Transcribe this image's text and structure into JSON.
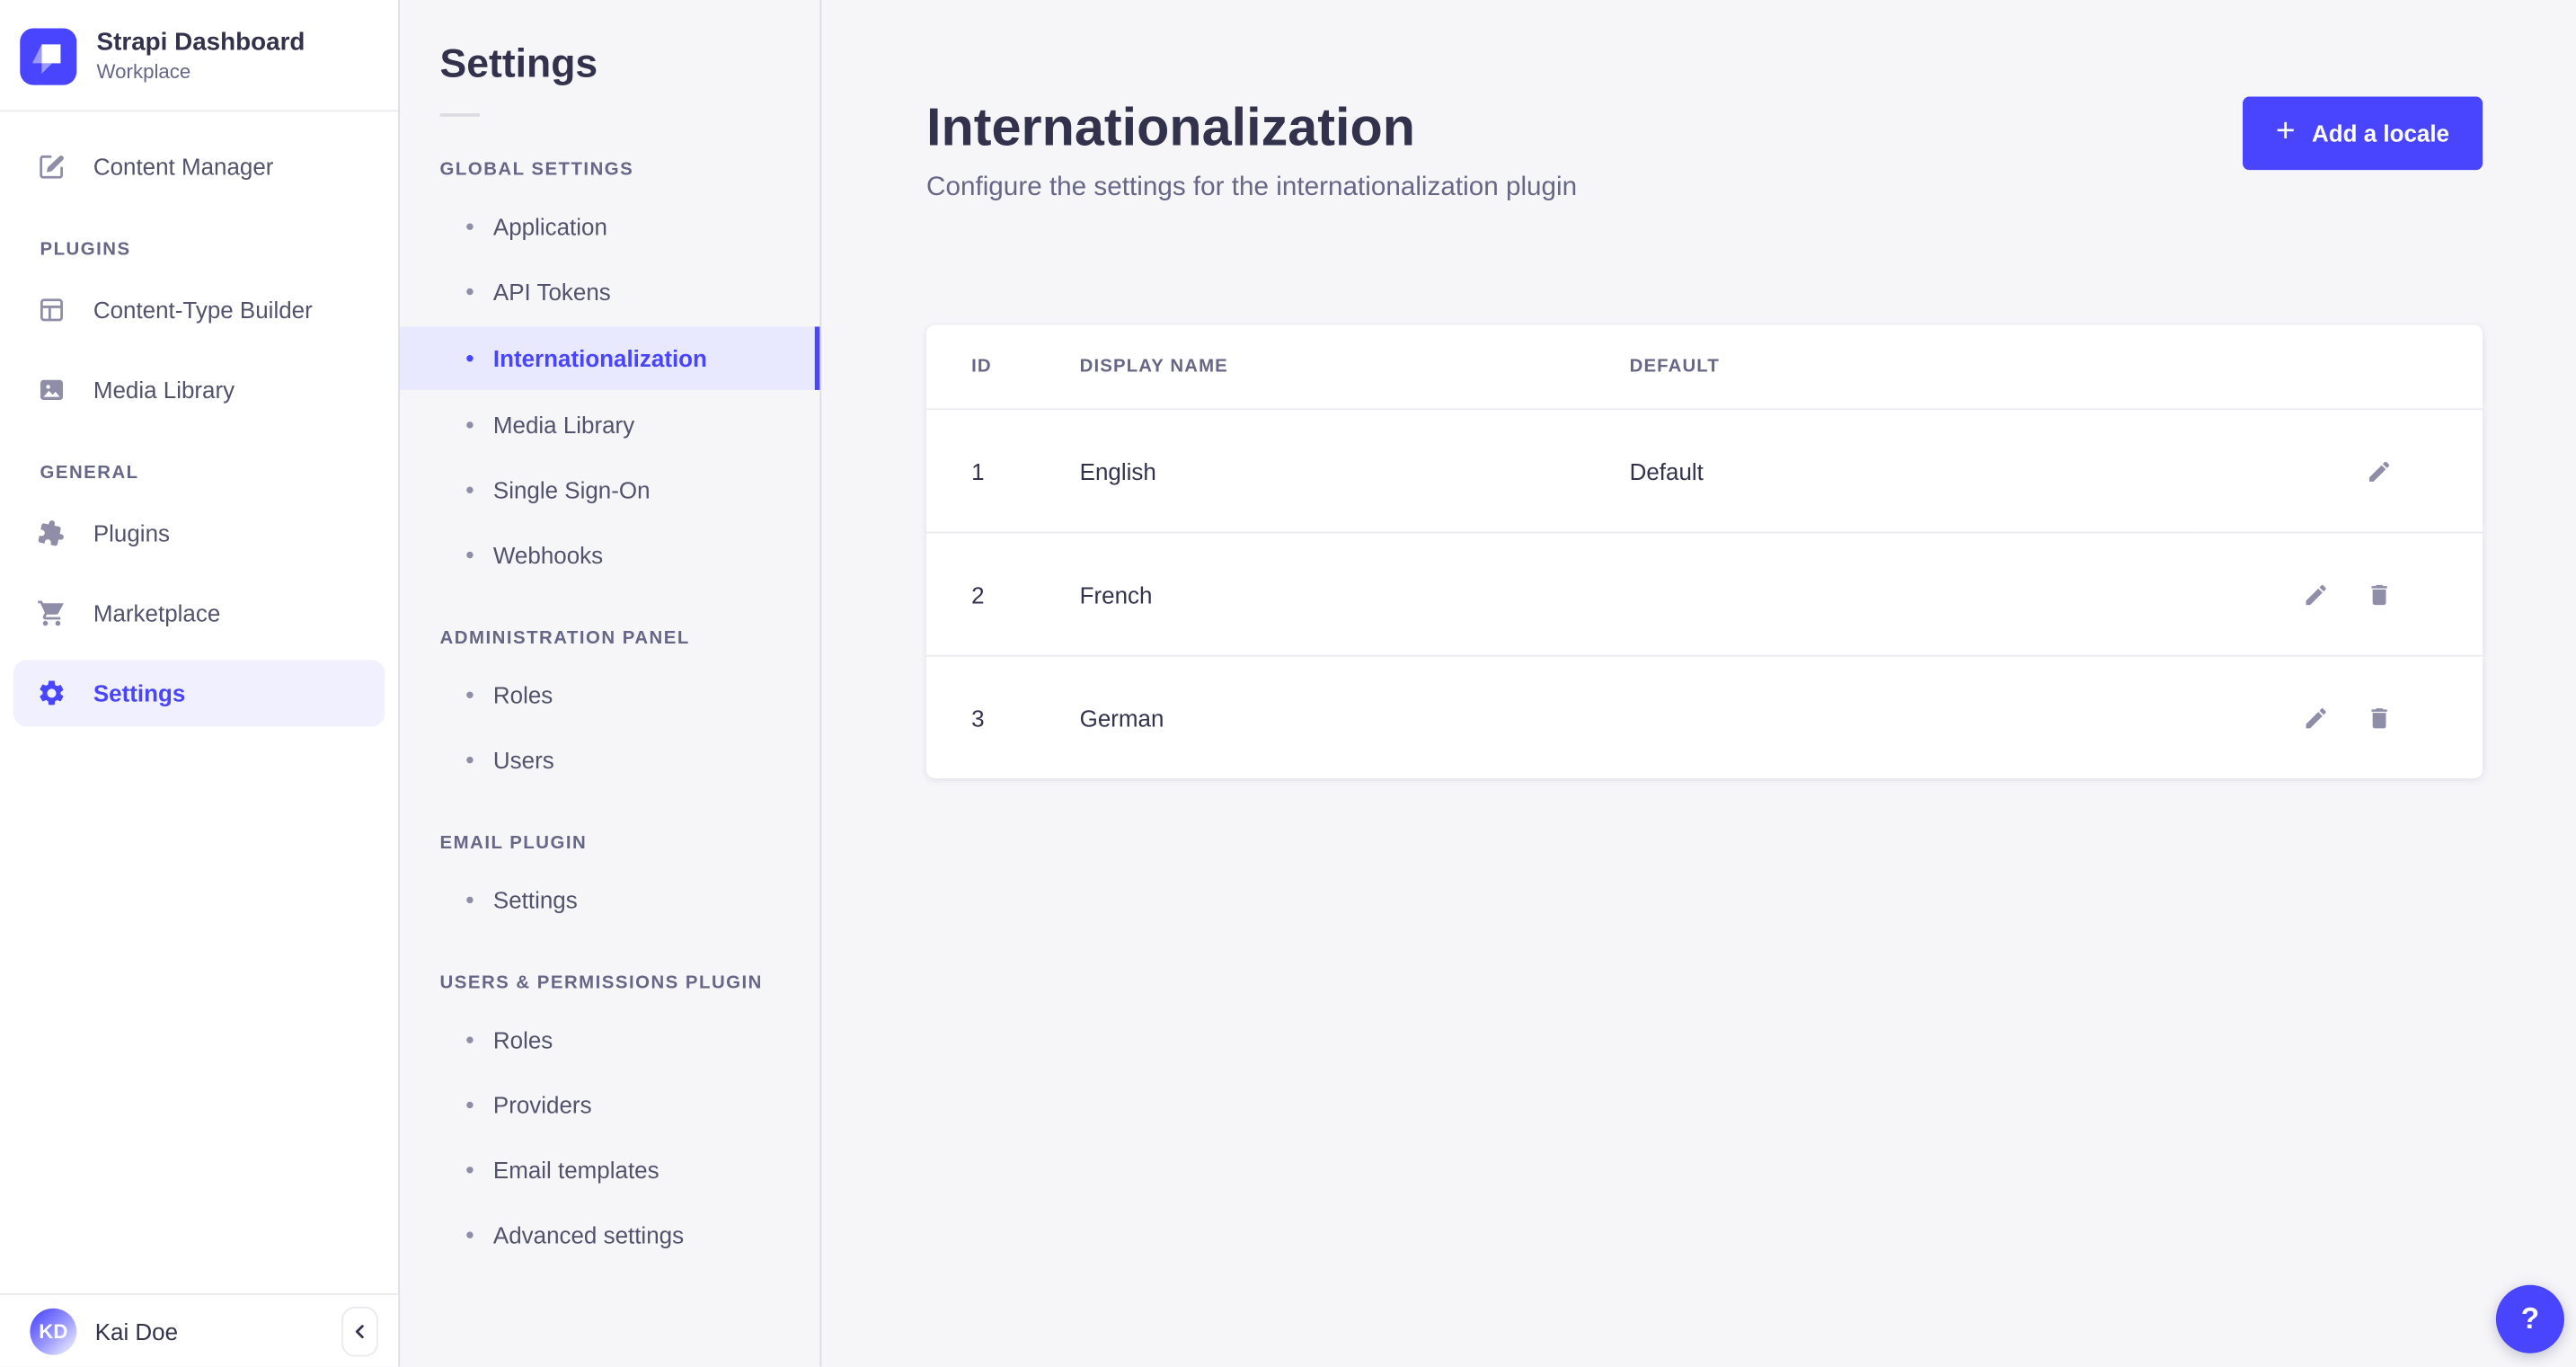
{
  "app": {
    "brand": {
      "title": "Strapi Dashboard",
      "subtitle": "Workplace"
    }
  },
  "colors": {
    "primary": "#4945ff",
    "primary_highlight": "#f0f0ff",
    "background": "#f6f6f9",
    "surface": "#ffffff",
    "border": "#eaeaef",
    "text_dark": "#32324d",
    "text_muted": "#666687",
    "icon_gray": "#8e8ea9"
  },
  "sidebar": {
    "content_manager": "Content Manager",
    "sections": [
      {
        "title": "PLUGINS",
        "items": [
          "Content-Type Builder",
          "Media Library"
        ]
      },
      {
        "title": "GENERAL",
        "items": [
          "Plugins",
          "Marketplace",
          "Settings"
        ]
      }
    ],
    "selected_item": "Settings",
    "user": {
      "initials": "KD",
      "name": "Kai Doe"
    }
  },
  "subnav": {
    "title": "Settings",
    "groups": [
      {
        "title": "GLOBAL SETTINGS",
        "items": [
          "Application",
          "API Tokens",
          "Internationalization",
          "Media Library",
          "Single Sign-On",
          "Webhooks"
        ]
      },
      {
        "title": "ADMINISTRATION PANEL",
        "items": [
          "Roles",
          "Users"
        ]
      },
      {
        "title": "EMAIL PLUGIN",
        "items": [
          "Settings"
        ]
      },
      {
        "title": "USERS & PERMISSIONS PLUGIN",
        "items": [
          "Roles",
          "Providers",
          "Email templates",
          "Advanced settings"
        ]
      }
    ],
    "selected_item": "Internationalization"
  },
  "main": {
    "title": "Internationalization",
    "subtitle": "Configure the settings for the internationalization plugin",
    "add_button": {
      "icon": "+",
      "label": "Add a locale"
    },
    "table": {
      "columns": [
        "ID",
        "DISPLAY NAME",
        "DEFAULT"
      ],
      "rows": [
        {
          "id": "1",
          "display_name": "English",
          "default": "Default"
        },
        {
          "id": "2",
          "display_name": "French",
          "default": ""
        },
        {
          "id": "3",
          "display_name": "German",
          "default": ""
        }
      ]
    }
  },
  "help": {
    "label": "?"
  }
}
